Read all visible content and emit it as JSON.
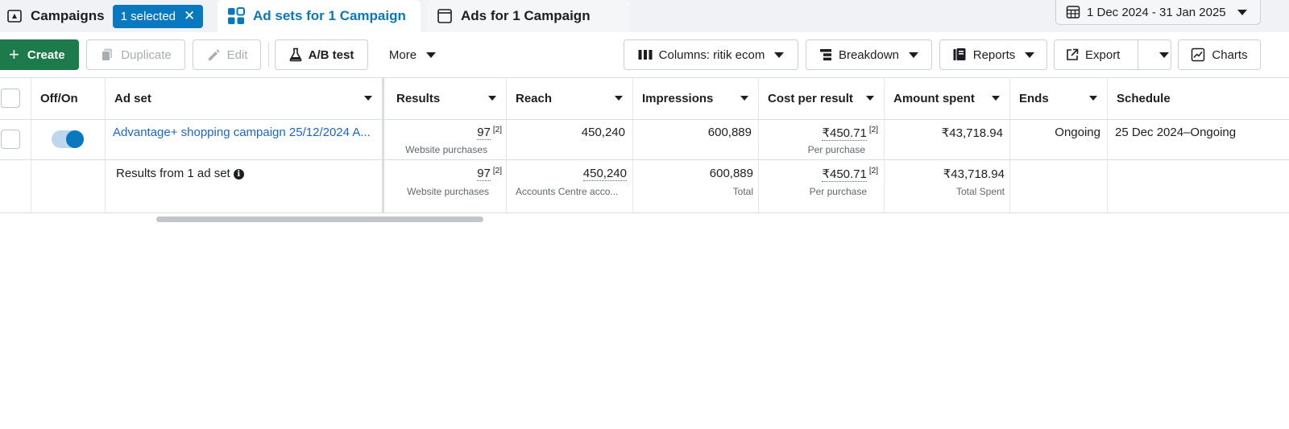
{
  "tabs": {
    "campaigns_label": "Campaigns",
    "selected_chip": "1 selected",
    "chip_close": "✕",
    "adsets_label": "Ad sets for 1 Campaign",
    "ads_label": "Ads for 1 Campaign"
  },
  "date_range": "1 Dec 2024 - 31 Jan 2025",
  "toolbar": {
    "create": "Create",
    "duplicate": "Duplicate",
    "edit": "Edit",
    "ab_test": "A/B test",
    "more": "More",
    "columns": "Columns: ritik ecom",
    "breakdown": "Breakdown",
    "reports": "Reports",
    "export": "Export",
    "charts": "Charts"
  },
  "table": {
    "headers": {
      "off_on": "Off/On",
      "ad_set": "Ad set",
      "results": "Results",
      "reach": "Reach",
      "impressions": "Impressions",
      "cost_per_result": "Cost per result",
      "amount_spent": "Amount spent",
      "ends": "Ends",
      "schedule": "Schedule"
    },
    "row": {
      "toggle_on": true,
      "ad_set_name": "Advantage+ shopping campaign 25/12/2024 A...",
      "results": "97",
      "results_sup": "[2]",
      "results_sub": "Website purchases",
      "reach": "450,240",
      "impressions": "600,889",
      "cost_per_result": "₹450.71",
      "cost_sup": "[2]",
      "cost_sub": "Per purchase",
      "amount_spent": "₹43,718.94",
      "ends": "Ongoing",
      "schedule": "25 Dec 2024–Ongoing"
    },
    "summary": {
      "label": "Results from 1 ad set",
      "results": "97",
      "results_sup": "[2]",
      "results_sub": "Website purchases",
      "reach": "450,240",
      "reach_sub": "Accounts Centre acco...",
      "impressions": "600,889",
      "impressions_sub": "Total",
      "cost_per_result": "₹450.71",
      "cost_sup": "[2]",
      "cost_sub": "Per purchase",
      "amount_spent": "₹43,718.94",
      "amount_sub": "Total Spent"
    }
  },
  "colors": {
    "accent_blue": "#0a78be",
    "create_green": "#1d7a4a",
    "link_blue": "#1b66c9"
  }
}
